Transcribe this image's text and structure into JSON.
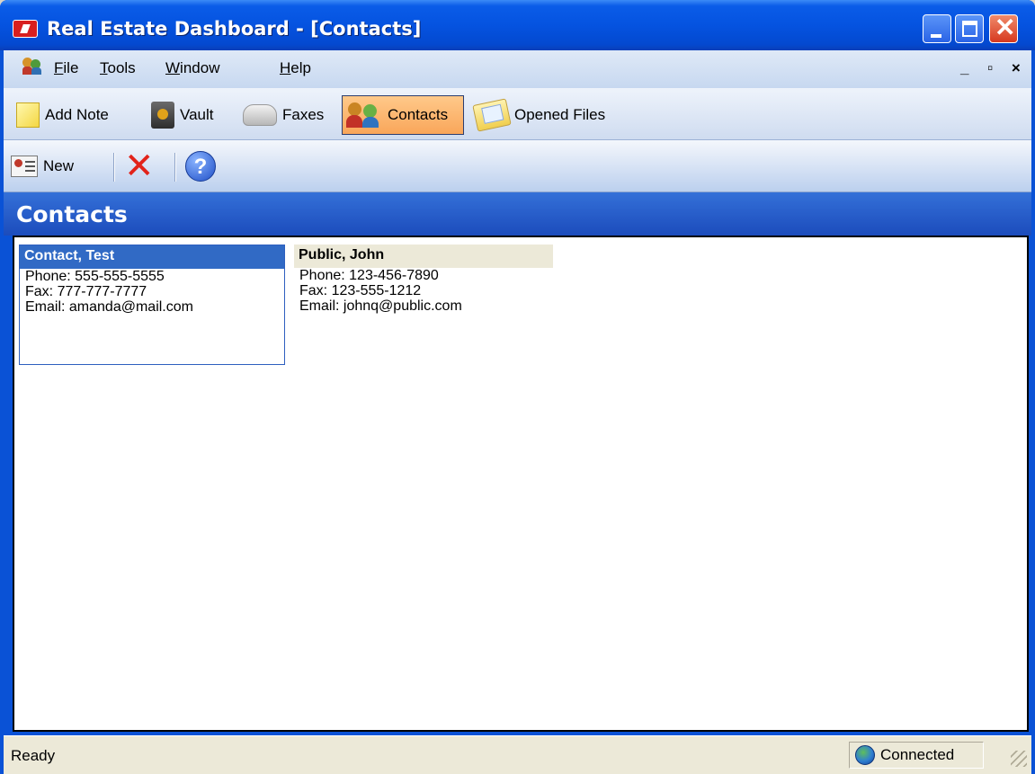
{
  "window": {
    "title": "Real Estate Dashboard - [Contacts]"
  },
  "menu": {
    "items": [
      {
        "label_u": "F",
        "label_rest": "ile"
      },
      {
        "label_u": "T",
        "label_rest": "ools"
      },
      {
        "label_u": "W",
        "label_rest": "indow"
      },
      {
        "label_u": "H",
        "label_rest": "elp"
      }
    ],
    "mdi_controls": "_ ▫ ×"
  },
  "nav": {
    "add_note": "Add Note",
    "vault": "Vault",
    "faxes": "Faxes",
    "contacts": "Contacts",
    "opened_files": "Opened Files"
  },
  "actions": {
    "new_label": "New",
    "delete_icon": "close-x",
    "help_icon": "question"
  },
  "section": {
    "title": "Contacts"
  },
  "contacts": [
    {
      "name": "Contact, Test",
      "phone": "Phone: 555-555-5555",
      "fax": "Fax: 777-777-7777",
      "email": "Email: amanda@mail.com",
      "selected": true
    },
    {
      "name": "Public, John",
      "phone": "Phone: 123-456-7890",
      "fax": "Fax: 123-555-1212",
      "email": "Email: johnq@public.com",
      "selected": false
    }
  ],
  "status": {
    "left": "Ready",
    "connection": "Connected"
  },
  "colors": {
    "titlebar": "#0553e0",
    "selected_card_header": "#316ac5",
    "active_nav": "#f9a65a",
    "delete_red": "#e2231a"
  }
}
